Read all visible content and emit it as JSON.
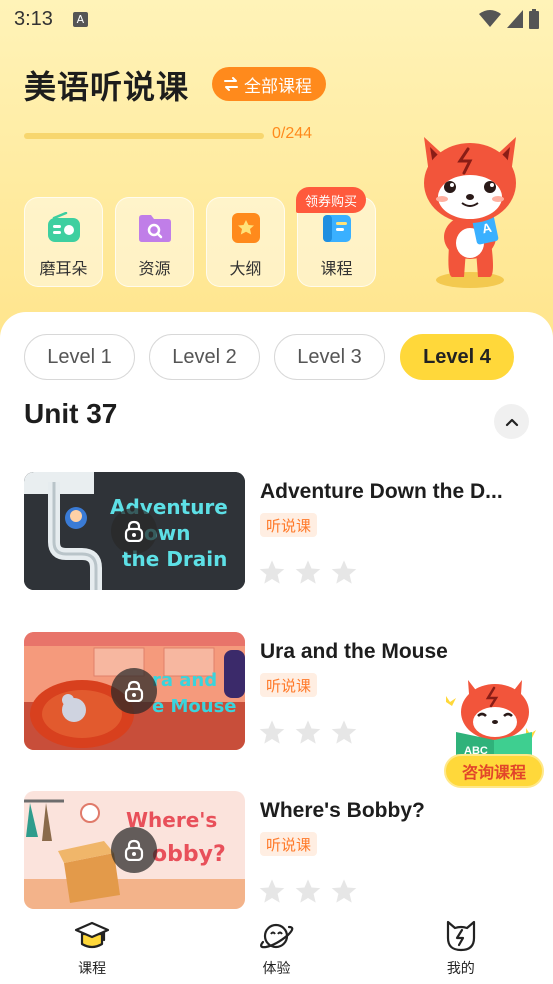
{
  "status_bar": {
    "time": "3:13",
    "indicator": "A"
  },
  "header": {
    "title": "美语听说课",
    "all_courses_label": "全部课程",
    "progress": {
      "done": 0,
      "total": 244,
      "text": "0/244"
    }
  },
  "shortcuts": [
    {
      "label": "磨耳朵",
      "icon": "radio-icon",
      "color": "#3ecfa0"
    },
    {
      "label": "资源",
      "icon": "folder-icon",
      "color": "#c07ee8"
    },
    {
      "label": "大纲",
      "icon": "outline-icon",
      "color": "#ff8a1c"
    },
    {
      "label": "课程",
      "icon": "book-icon",
      "color": "#3ab0ff",
      "badge": "领券购买"
    }
  ],
  "levels": [
    {
      "label": "Level 1",
      "active": false
    },
    {
      "label": "Level 2",
      "active": false
    },
    {
      "label": "Level 3",
      "active": false
    },
    {
      "label": "Level 4",
      "active": true
    }
  ],
  "unit": {
    "title": "Unit 37"
  },
  "courses": [
    {
      "name": "Adventure Down the D...",
      "tag": "听说课",
      "rating": 0,
      "max_rating": 3,
      "thumb_text": "Adventure Down the Drain",
      "locked": true
    },
    {
      "name": "Ura and the Mouse",
      "tag": "听说课",
      "rating": 0,
      "max_rating": 3,
      "thumb_text": "Ura and the Mouse",
      "locked": true
    },
    {
      "name": "Where's Bobby?",
      "tag": "听说课",
      "rating": 0,
      "max_rating": 3,
      "thumb_text": "Where's Bobby?",
      "locked": true
    }
  ],
  "consult": {
    "label": "咨询课程"
  },
  "bottom_nav": [
    {
      "label": "课程",
      "icon": "graduation-cap-icon"
    },
    {
      "label": "体验",
      "icon": "planet-icon"
    },
    {
      "label": "我的",
      "icon": "cat-face-icon"
    }
  ]
}
